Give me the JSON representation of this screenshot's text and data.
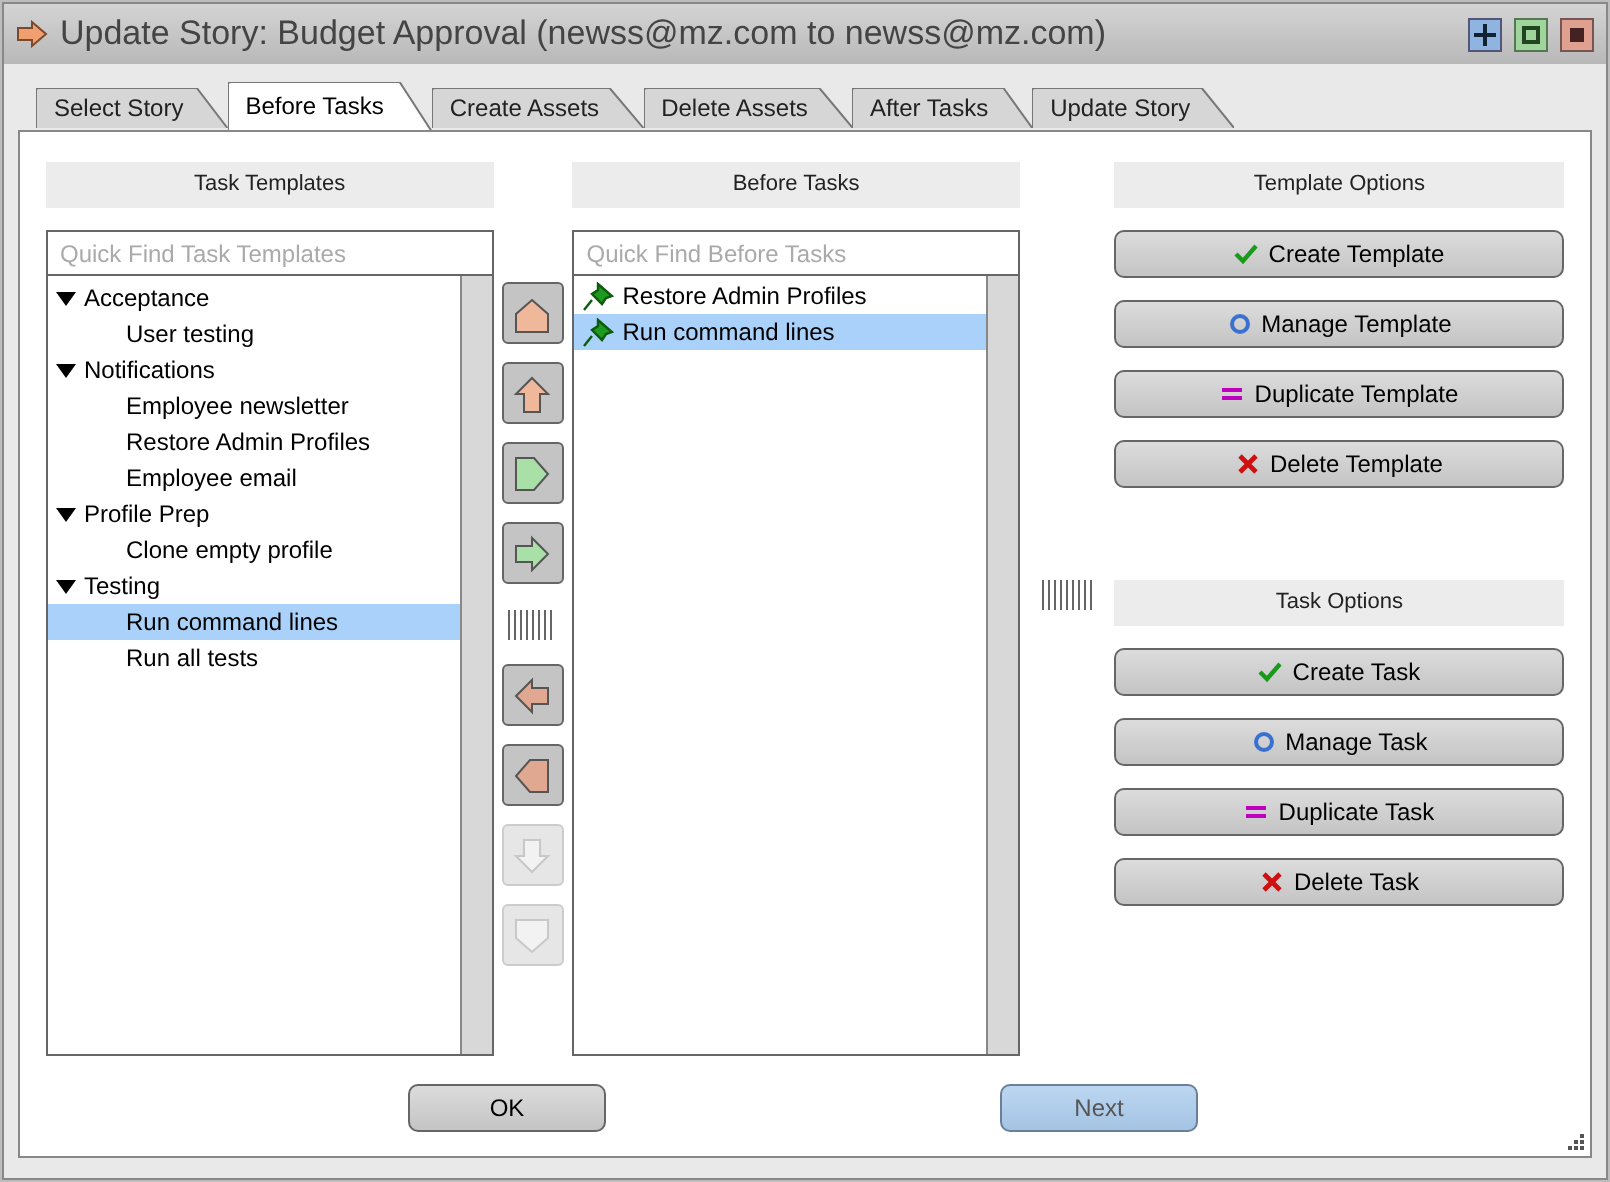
{
  "window": {
    "title": "Update Story: Budget Approval (newss@mz.com to newss@mz.com)"
  },
  "tabs": [
    {
      "label": "Select Story",
      "selected": false
    },
    {
      "label": "Before Tasks",
      "selected": true
    },
    {
      "label": "Create Assets",
      "selected": false
    },
    {
      "label": "Delete Assets",
      "selected": false
    },
    {
      "label": "After Tasks",
      "selected": false
    },
    {
      "label": "Update Story",
      "selected": false
    }
  ],
  "templates": {
    "header": "Task Templates",
    "search": {
      "placeholder": "Quick Find Task Templates"
    },
    "tree": [
      {
        "label": "Acceptance",
        "expanded": true,
        "selected": false,
        "children": [
          {
            "label": "User testing",
            "selected": false
          }
        ]
      },
      {
        "label": "Notifications",
        "expanded": true,
        "selected": false,
        "children": [
          {
            "label": "Employee newsletter",
            "selected": false
          },
          {
            "label": "Restore Admin Profiles",
            "selected": false
          },
          {
            "label": "Employee email",
            "selected": false
          }
        ]
      },
      {
        "label": "Profile Prep",
        "expanded": true,
        "selected": false,
        "children": [
          {
            "label": "Clone empty profile",
            "selected": false
          }
        ]
      },
      {
        "label": "Testing",
        "expanded": true,
        "selected": false,
        "children": [
          {
            "label": "Run command lines",
            "selected": true
          },
          {
            "label": "Run all tests",
            "selected": false
          }
        ]
      }
    ]
  },
  "move_buttons": [
    {
      "kind": "top",
      "disabled": false
    },
    {
      "kind": "up",
      "disabled": false
    },
    {
      "kind": "add_all",
      "disabled": false
    },
    {
      "kind": "add",
      "disabled": false
    },
    {
      "kind": "remove",
      "disabled": false
    },
    {
      "kind": "remove_all",
      "disabled": false
    },
    {
      "kind": "down",
      "disabled": true
    },
    {
      "kind": "bottom",
      "disabled": true
    }
  ],
  "before_tasks": {
    "header": "Before Tasks",
    "search": {
      "placeholder": "Quick Find Before Tasks"
    },
    "items": [
      {
        "label": "Restore Admin Profiles",
        "selected": false
      },
      {
        "label": "Run command lines",
        "selected": true
      }
    ]
  },
  "template_options": {
    "header": "Template Options",
    "buttons": [
      {
        "label": "Create Template",
        "kind": "create"
      },
      {
        "label": "Manage Template",
        "kind": "manage"
      },
      {
        "label": "Duplicate Template",
        "kind": "duplicate"
      },
      {
        "label": "Delete Template",
        "kind": "delete"
      }
    ]
  },
  "task_options": {
    "header": "Task Options",
    "buttons": [
      {
        "label": "Create Task",
        "kind": "create"
      },
      {
        "label": "Manage Task",
        "kind": "manage"
      },
      {
        "label": "Duplicate Task",
        "kind": "duplicate"
      },
      {
        "label": "Delete Task",
        "kind": "delete"
      }
    ]
  },
  "footer": [
    {
      "label": "OK",
      "kind": "normal"
    },
    {
      "label": "Next",
      "kind": "highlight"
    }
  ]
}
